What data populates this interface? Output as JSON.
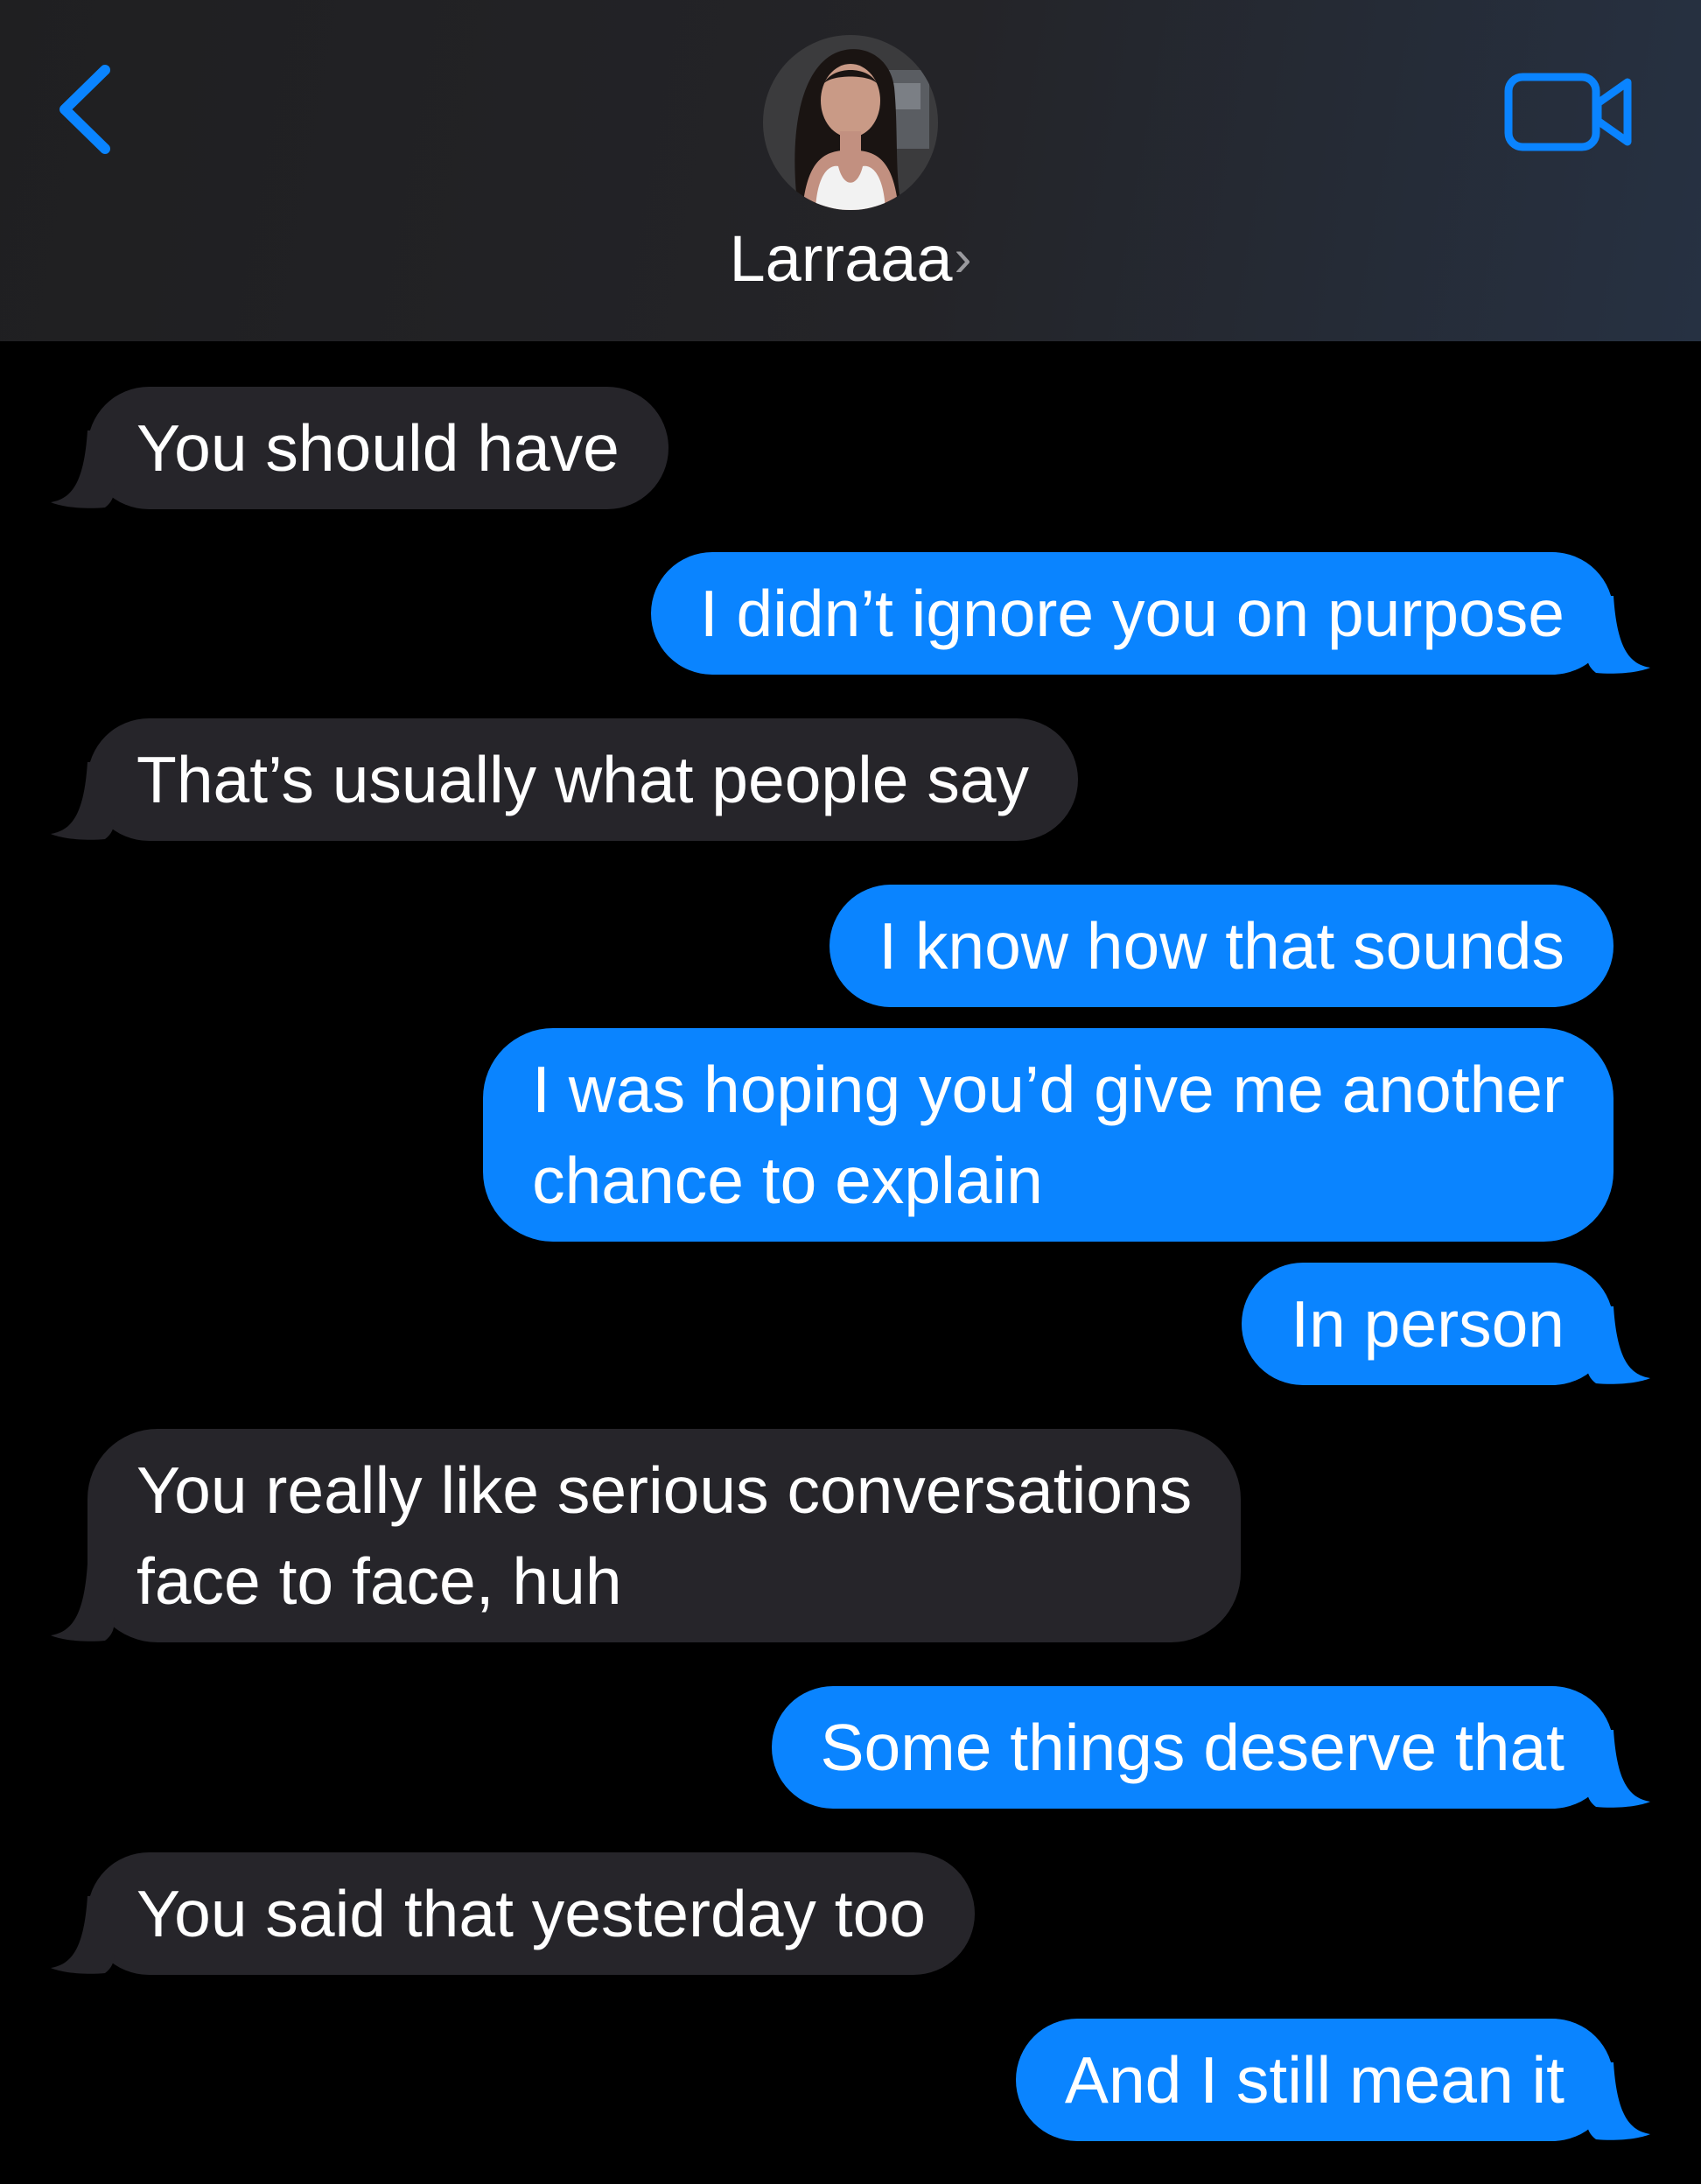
{
  "header": {
    "contact_name": "Larraaa",
    "chevron": "›",
    "back_icon": "chevron-left-icon",
    "video_icon": "video-camera-icon",
    "accent_color": "#0a84ff"
  },
  "messages": [
    {
      "direction": "incoming",
      "text": "You should have",
      "tail": true
    },
    {
      "direction": "outgoing",
      "text": "I didn’t ignore you on purpose",
      "tail": true
    },
    {
      "direction": "incoming",
      "text": "That’s usually what people say",
      "tail": true
    },
    {
      "direction": "outgoing",
      "text": "I know how that sounds",
      "tail": false
    },
    {
      "direction": "outgoing",
      "lines": [
        "I was hoping you’d give me another",
        "chance to explain"
      ],
      "tail": false
    },
    {
      "direction": "outgoing",
      "text": "In person",
      "tail": true
    },
    {
      "direction": "incoming",
      "lines": [
        "You really like serious conversations",
        "face to face, huh"
      ],
      "tail": true
    },
    {
      "direction": "outgoing",
      "text": "Some things deserve that",
      "tail": true
    },
    {
      "direction": "incoming",
      "text": "You said that yesterday too",
      "tail": true
    },
    {
      "direction": "outgoing",
      "text": "And I still mean it",
      "tail": true
    }
  ],
  "colors": {
    "incoming_bubble": "#26252a",
    "outgoing_bubble": "#0a84ff",
    "background": "#000000"
  }
}
